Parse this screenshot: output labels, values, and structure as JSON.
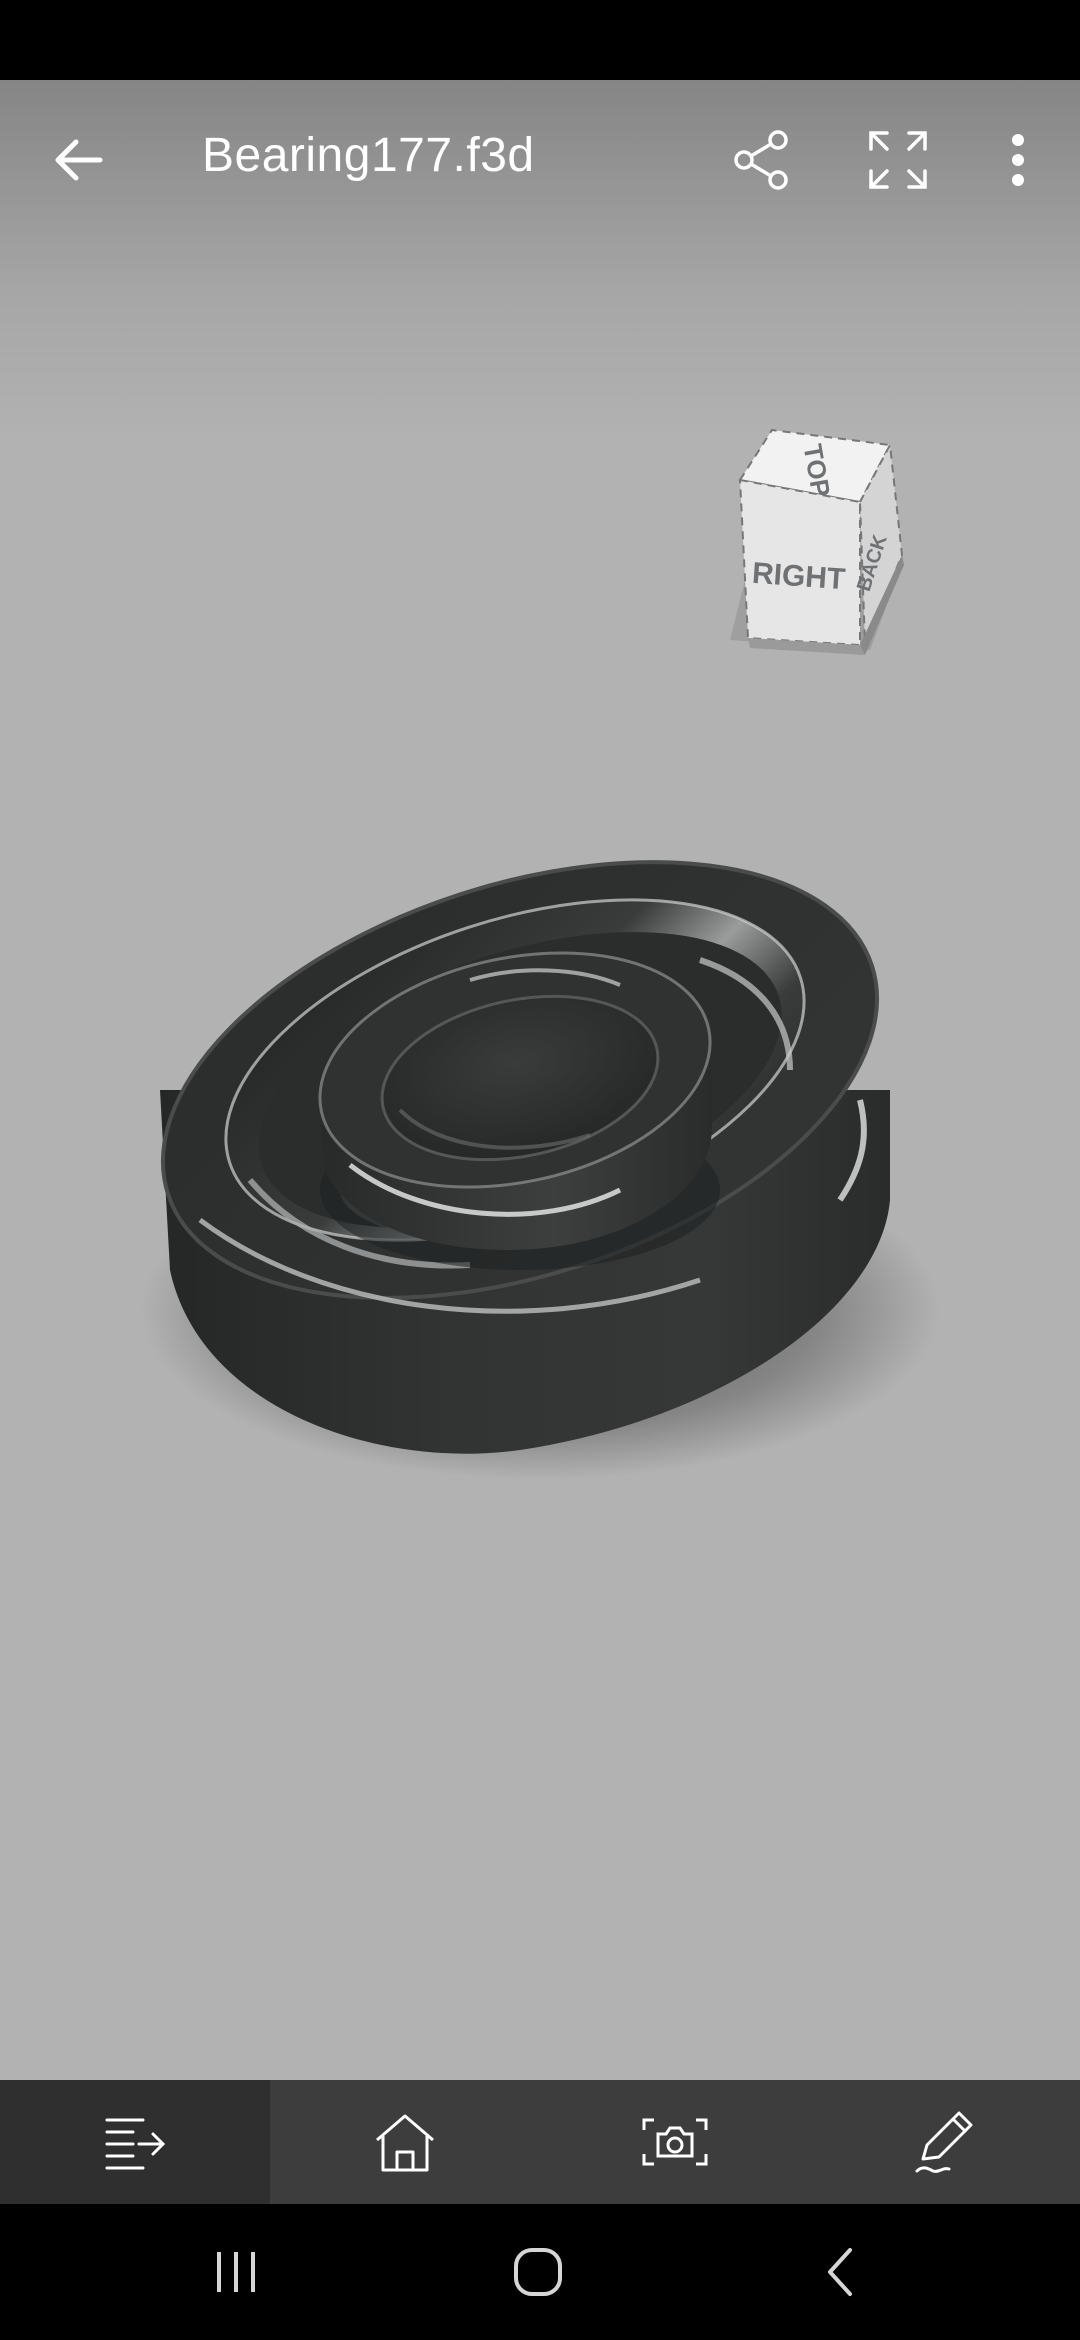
{
  "app_bar": {
    "back_icon": "arrow-left-icon",
    "title": "Bearing177.f3d",
    "share_icon": "share-icon",
    "fullscreen_icon": "fullscreen-icon",
    "more_icon": "more-vertical-icon"
  },
  "viewcube": {
    "top": "TOP",
    "right": "RIGHT",
    "back": "BACK"
  },
  "model": {
    "name": "bearing-3d-model",
    "color": "#2e3030"
  },
  "toolbar": {
    "items": [
      {
        "icon": "browser-list-icon",
        "active": true
      },
      {
        "icon": "home-icon",
        "active": false
      },
      {
        "icon": "camera-icon",
        "active": false
      },
      {
        "icon": "pencil-markup-icon",
        "active": false
      }
    ]
  },
  "system_nav": {
    "recents_icon": "recents-icon",
    "home_icon": "home-circle-icon",
    "back_icon": "back-chevron-icon"
  }
}
